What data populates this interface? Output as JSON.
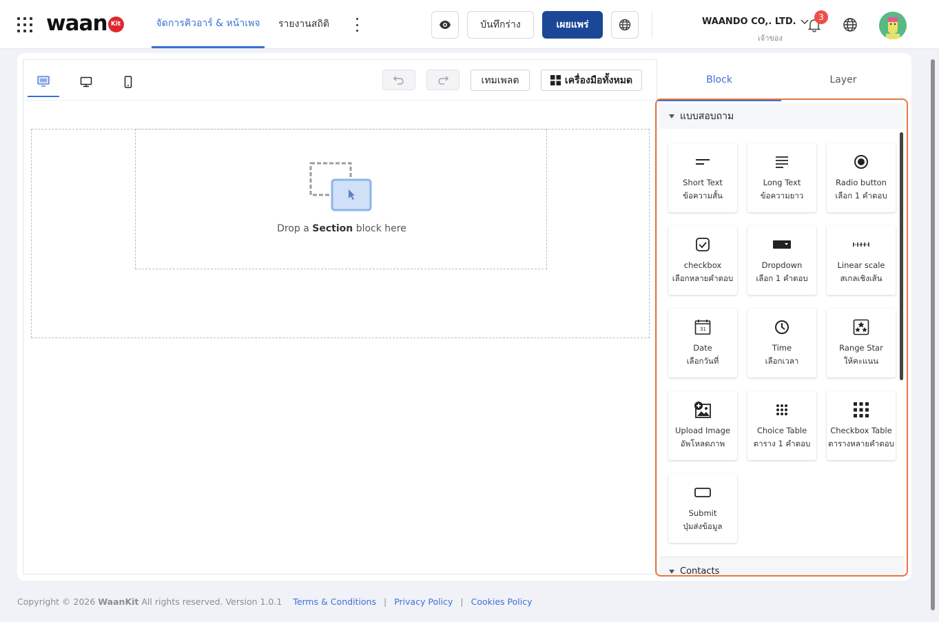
{
  "header": {
    "logo_text": "waan",
    "logo_badge": "Kit",
    "nav": [
      {
        "label": "จัดการคิวอาร์ & หน้าเพจ"
      },
      {
        "label": "รายงานสถิติ"
      }
    ],
    "save_draft_label": "บันทึกร่าง",
    "publish_label": "เผยแพร่",
    "company_name": "WAANDO CO,. LTD.",
    "role": "เจ้าของ",
    "notification_count": "3"
  },
  "editor": {
    "template_label": "เทมเพลต",
    "all_tools_label": "เครื่องมือทั้งหมด",
    "drop_prefix": "Drop a",
    "drop_bold": "Section",
    "drop_suffix": "block here"
  },
  "panel": {
    "tabs": [
      {
        "label": "Block"
      },
      {
        "label": "Layer"
      }
    ],
    "section_title": "แบบสอบถาม",
    "blocks": [
      {
        "name": "Short Text",
        "desc": "ข้อความสั้น",
        "icon": "short-text-icon"
      },
      {
        "name": "Long Text",
        "desc": "ข้อความยาว",
        "icon": "long-text-icon"
      },
      {
        "name": "Radio button",
        "desc": "เลือก 1 คำตอบ",
        "icon": "radio-icon"
      },
      {
        "name": "checkbox",
        "desc": "เลือกหลายคำตอบ",
        "icon": "checkbox-icon"
      },
      {
        "name": "Dropdown",
        "desc": "เลือก 1 คำตอบ",
        "icon": "dropdown-icon"
      },
      {
        "name": "Linear scale",
        "desc": "สเกลเชิงเส้น",
        "icon": "linear-scale-icon"
      },
      {
        "name": "Date",
        "desc": "เลือกวันที่",
        "icon": "calendar-icon"
      },
      {
        "name": "Time",
        "desc": "เลือกเวลา",
        "icon": "clock-icon"
      },
      {
        "name": "Range Star",
        "desc": "ให้คะแนน",
        "icon": "star-rating-icon"
      },
      {
        "name": "Upload Image",
        "desc": "อัพโหลดภาพ",
        "icon": "upload-image-icon"
      },
      {
        "name": "Choice Table",
        "desc": "ตาราง 1 คำตอบ",
        "icon": "choice-table-icon"
      },
      {
        "name": "Checkbox Table",
        "desc": "ตารางหลายคำตอบ",
        "icon": "checkbox-table-icon"
      },
      {
        "name": "Submit",
        "desc": "ปุ่มส่งข้อมูล",
        "icon": "submit-button-icon"
      }
    ],
    "next_section": "Contacts"
  },
  "footer": {
    "copyright_prefix": "Copyright © 2026",
    "brand": "WaanKit",
    "copyright_suffix": "All rights reserved. Version 1.0.1",
    "terms": "Terms & Conditions",
    "privacy": "Privacy Policy",
    "cookies": "Cookies Policy"
  },
  "colors": {
    "accent": "#3a6fd8",
    "publish": "#1c4796",
    "highlight": "#e8763e",
    "badge": "#ee4d4d"
  }
}
